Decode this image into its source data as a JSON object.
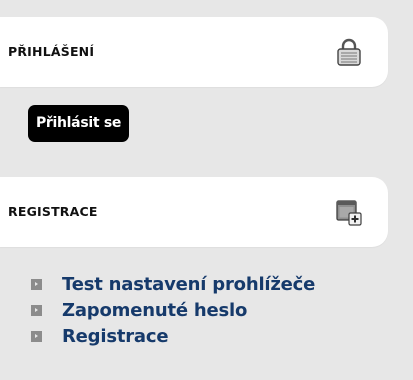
{
  "login": {
    "title": "PŘIHLÁŠENÍ",
    "icon": "padlock-icon",
    "button_label": "Přihlásit se"
  },
  "register": {
    "title": "REGISTRACE",
    "icon": "add-window-icon"
  },
  "links": [
    {
      "label": "Test nastavení prohlížeče"
    },
    {
      "label": "Zapomenuté heslo"
    },
    {
      "label": "Registrace"
    }
  ],
  "colors": {
    "background": "#e7e7e7",
    "header": "#ffffff",
    "button": "#000000",
    "link": "#163a6b",
    "bullet": "#8c8c8c"
  }
}
